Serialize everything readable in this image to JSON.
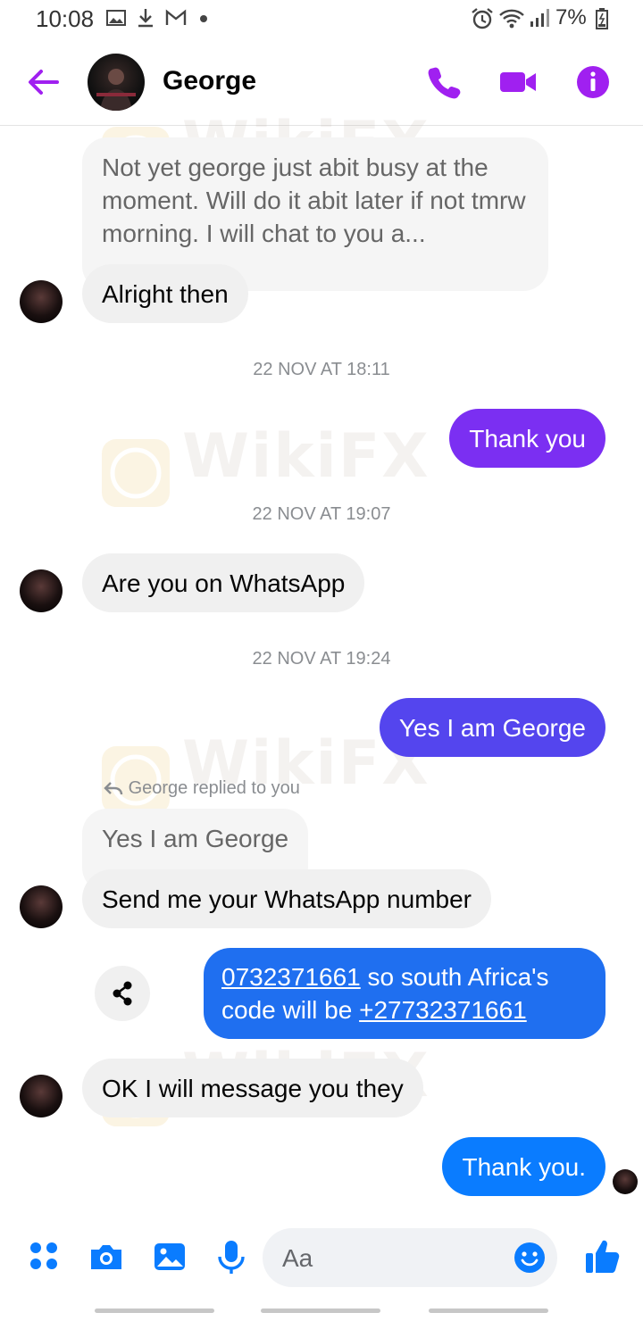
{
  "status_bar": {
    "time": "10:08",
    "battery_pct": "7%"
  },
  "header": {
    "contact_name": "George"
  },
  "messages": {
    "m1_quoted": "Not yet george just abit busy at the moment. Will do it abit later  if not tmrw morning. I will chat to you a...",
    "m1_reply": "Alright then",
    "ts1": "22 NOV AT 18:11",
    "m2": "Thank you",
    "ts2": "22 NOV AT 19:07",
    "m3": "Are you on WhatsApp",
    "ts3": "22 NOV AT 19:24",
    "m4": "Yes I am George",
    "reply_label": "George replied to you",
    "m5_quoted": "Yes I am George",
    "m5_reply": "Send me your WhatsApp number",
    "m6_number": "0732371661",
    "m6_mid": " so south Africa's code will be ",
    "m6_intl": "+27732371661",
    "m7": "OK I will message you they",
    "m8": "Thank you."
  },
  "composer": {
    "placeholder": "Aa"
  },
  "watermark": "WikiFX",
  "colors": {
    "accent": "#a020f0",
    "blue": "#0a7cff",
    "purple_bubble": "#7b2ff2"
  }
}
